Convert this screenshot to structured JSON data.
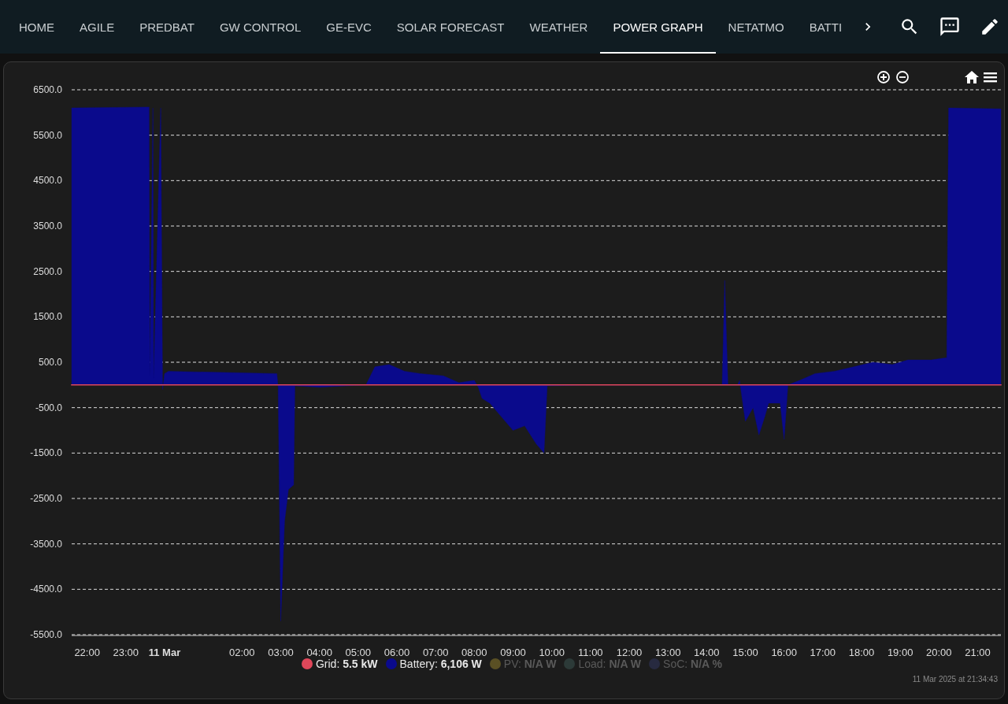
{
  "tabs": [
    {
      "label": "HOME",
      "selected": false
    },
    {
      "label": "AGILE",
      "selected": false
    },
    {
      "label": "PREDBAT",
      "selected": false
    },
    {
      "label": "GW CONTROL",
      "selected": false
    },
    {
      "label": "GE-EVC",
      "selected": false
    },
    {
      "label": "SOLAR FORECAST",
      "selected": false
    },
    {
      "label": "WEATHER",
      "selected": false
    },
    {
      "label": "POWER GRAPH",
      "selected": true
    },
    {
      "label": "NETATMO",
      "selected": false
    },
    {
      "label": "BATTI",
      "selected": false
    }
  ],
  "chart": {
    "chart_data": {
      "type": "area",
      "grid": true,
      "x": [
        "2025-03-10T21:36",
        "2025-03-10T23:36",
        "2025-03-10T23:37",
        "2025-03-10T23:42",
        "2025-03-10T23:43",
        "2025-03-10T23:54",
        "2025-03-10T23:57",
        "2025-03-11T00:00",
        "2025-03-11T00:06",
        "2025-03-11T02:54",
        "2025-03-11T02:56",
        "2025-03-11T03:00",
        "2025-03-11T03:06",
        "2025-03-11T03:12",
        "2025-03-11T03:20",
        "2025-03-11T03:22",
        "2025-03-11T04:00",
        "2025-03-11T05:12",
        "2025-03-11T05:26",
        "2025-03-11T05:48",
        "2025-03-11T06:12",
        "2025-03-11T06:36",
        "2025-03-11T07:12",
        "2025-03-11T07:36",
        "2025-03-11T08:00",
        "2025-03-11T08:06",
        "2025-03-11T08:12",
        "2025-03-11T08:24",
        "2025-03-11T08:42",
        "2025-03-11T09:00",
        "2025-03-11T09:18",
        "2025-03-11T09:36",
        "2025-03-11T09:48",
        "2025-03-11T09:53",
        "2025-03-11T11:00",
        "2025-03-11T13:00",
        "2025-03-11T14:24",
        "2025-03-11T14:28",
        "2025-03-11T14:33",
        "2025-03-11T14:48",
        "2025-03-11T14:51",
        "2025-03-11T15:00",
        "2025-03-11T15:12",
        "2025-03-11T15:21",
        "2025-03-11T15:30",
        "2025-03-11T15:36",
        "2025-03-11T15:54",
        "2025-03-11T16:00",
        "2025-03-11T16:06",
        "2025-03-11T16:24",
        "2025-03-11T16:48",
        "2025-03-11T17:18",
        "2025-03-11T17:48",
        "2025-03-11T18:18",
        "2025-03-11T18:48",
        "2025-03-11T19:12",
        "2025-03-11T19:48",
        "2025-03-11T20:12",
        "2025-03-11T20:15",
        "2025-03-11T21:36"
      ],
      "series": [
        {
          "name": "Grid",
          "color": "#e0475a",
          "values": [
            0,
            0,
            0,
            0,
            0,
            0,
            0,
            0,
            0,
            0,
            0,
            0,
            0,
            0,
            0,
            0,
            0,
            0,
            0,
            0,
            0,
            0,
            0,
            0,
            0,
            0,
            0,
            0,
            0,
            0,
            0,
            0,
            0,
            0,
            0,
            0,
            0,
            0,
            0,
            0,
            0,
            0,
            0,
            0,
            0,
            0,
            0,
            0,
            0,
            0,
            0,
            0,
            0,
            0,
            0,
            0,
            0,
            0,
            0,
            0
          ]
        },
        {
          "name": "Battery",
          "color": "#0a0a8c",
          "values": [
            6100,
            6120,
            200,
            6100,
            150,
            6100,
            -100,
            250,
            300,
            250,
            -50,
            -5200,
            -3000,
            -2300,
            -2200,
            -20,
            -50,
            0,
            400,
            450,
            300,
            250,
            200,
            50,
            100,
            -50,
            -300,
            -400,
            -700,
            -1000,
            -900,
            -1300,
            -1500,
            -20,
            0,
            0,
            0,
            2300,
            0,
            0,
            100,
            -800,
            -500,
            -1100,
            -700,
            -400,
            -400,
            -1200,
            0,
            100,
            250,
            300,
            400,
            500,
            450,
            550,
            550,
            600,
            6100,
            6080
          ]
        },
        {
          "name": "PV",
          "color": "#5a5024",
          "values": [
            null,
            null,
            null,
            null,
            null,
            null,
            null,
            null,
            null,
            null,
            null,
            null,
            null,
            null,
            null,
            null,
            null,
            null,
            null,
            null,
            null,
            null,
            null,
            null,
            null,
            null,
            null,
            null,
            null,
            null,
            null,
            null,
            null,
            null,
            null,
            null,
            null,
            null,
            null,
            null,
            null,
            null,
            null,
            null,
            null,
            null,
            null,
            null,
            null,
            null,
            null,
            null,
            null,
            null,
            null,
            null,
            null,
            null,
            null,
            null
          ]
        },
        {
          "name": "Load",
          "color": "#2c3a38",
          "values": [
            null,
            null,
            null,
            null,
            null,
            null,
            null,
            null,
            null,
            null,
            null,
            null,
            null,
            null,
            null,
            null,
            null,
            null,
            null,
            null,
            null,
            null,
            null,
            null,
            null,
            null,
            null,
            null,
            null,
            null,
            null,
            null,
            null,
            null,
            null,
            null,
            null,
            null,
            null,
            null,
            null,
            null,
            null,
            null,
            null,
            null,
            null,
            null,
            null,
            null,
            null,
            null,
            null,
            null,
            null,
            null,
            null,
            null,
            null,
            null
          ]
        },
        {
          "name": "SoC",
          "color": "#272a40",
          "values": [
            null,
            null,
            null,
            null,
            null,
            null,
            null,
            null,
            null,
            null,
            null,
            null,
            null,
            null,
            null,
            null,
            null,
            null,
            null,
            null,
            null,
            null,
            null,
            null,
            null,
            null,
            null,
            null,
            null,
            null,
            null,
            null,
            null,
            null,
            null,
            null,
            null,
            null,
            null,
            null,
            null,
            null,
            null,
            null,
            null,
            null,
            null,
            null,
            null,
            null,
            null,
            null,
            null,
            null,
            null,
            null,
            null,
            null,
            null,
            null
          ]
        }
      ],
      "xlim": [
        "2025-03-10T21:36",
        "2025-03-11T21:36"
      ],
      "ylim": [
        -5500,
        6500
      ],
      "xticks": [
        {
          "value": "2025-03-10T22:00",
          "label": "22:00"
        },
        {
          "value": "2025-03-10T23:00",
          "label": "23:00"
        },
        {
          "value": "2025-03-11T00:00",
          "label": "11 Mar"
        },
        {
          "value": "2025-03-11T02:00",
          "label": "02:00"
        },
        {
          "value": "2025-03-11T03:00",
          "label": "03:00"
        },
        {
          "value": "2025-03-11T04:00",
          "label": "04:00"
        },
        {
          "value": "2025-03-11T05:00",
          "label": "05:00"
        },
        {
          "value": "2025-03-11T06:00",
          "label": "06:00"
        },
        {
          "value": "2025-03-11T07:00",
          "label": "07:00"
        },
        {
          "value": "2025-03-11T08:00",
          "label": "08:00"
        },
        {
          "value": "2025-03-11T09:00",
          "label": "09:00"
        },
        {
          "value": "2025-03-11T10:00",
          "label": "10:00"
        },
        {
          "value": "2025-03-11T11:00",
          "label": "11:00"
        },
        {
          "value": "2025-03-11T12:00",
          "label": "12:00"
        },
        {
          "value": "2025-03-11T13:00",
          "label": "13:00"
        },
        {
          "value": "2025-03-11T14:00",
          "label": "14:00"
        },
        {
          "value": "2025-03-11T15:00",
          "label": "15:00"
        },
        {
          "value": "2025-03-11T16:00",
          "label": "16:00"
        },
        {
          "value": "2025-03-11T17:00",
          "label": "17:00"
        },
        {
          "value": "2025-03-11T18:00",
          "label": "18:00"
        },
        {
          "value": "2025-03-11T19:00",
          "label": "19:00"
        },
        {
          "value": "2025-03-11T20:00",
          "label": "20:00"
        },
        {
          "value": "2025-03-11T21:00",
          "label": "21:00"
        }
      ],
      "yticks": [
        {
          "value": 6500,
          "label": "6500.0"
        },
        {
          "value": 5500,
          "label": "5500.0"
        },
        {
          "value": 4500,
          "label": "4500.0"
        },
        {
          "value": 3500,
          "label": "3500.0"
        },
        {
          "value": 2500,
          "label": "2500.0"
        },
        {
          "value": 1500,
          "label": "1500.0"
        },
        {
          "value": 500,
          "label": "500.0"
        },
        {
          "value": -500,
          "label": "-500.0"
        },
        {
          "value": -1500,
          "label": "-1500.0"
        },
        {
          "value": -2500,
          "label": "-2500.0"
        },
        {
          "value": -3500,
          "label": "-3500.0"
        },
        {
          "value": -4500,
          "label": "-4500.0"
        },
        {
          "value": -5500,
          "label": "-5500.0"
        }
      ]
    },
    "legend": [
      {
        "separator": ":",
        "value": "5.5 kW",
        "enabled": true
      },
      {
        "separator": ":",
        "value": "6,106 W",
        "enabled": true
      },
      {
        "separator": ":",
        "value": "N/A W",
        "enabled": false
      },
      {
        "separator": ":",
        "value": "N/A W",
        "enabled": false
      },
      {
        "separator": ":",
        "value": "N/A %",
        "enabled": false
      }
    ],
    "timestamp": "11 Mar 2025 at 21:34:43"
  }
}
